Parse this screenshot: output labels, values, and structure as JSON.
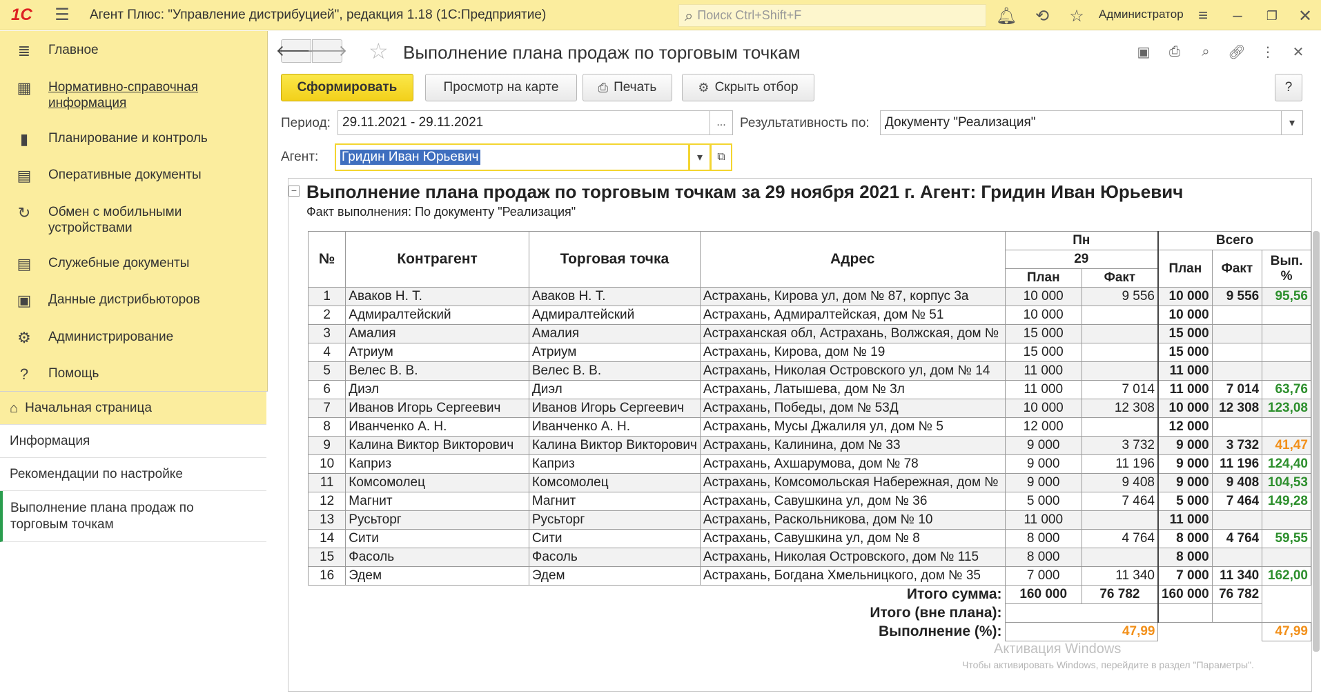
{
  "titlebar": {
    "logo": "1С",
    "title": "Агент Плюс: \"Управление дистрибуцией\", редакция 1.18  (1С:Предприятие)",
    "search_placeholder": "Поиск Ctrl+Shift+F",
    "user": "Администратор"
  },
  "sidebar": {
    "items": [
      {
        "label": "Главное",
        "icon": "menu-lines-icon"
      },
      {
        "label": "Нормативно-справочная информация",
        "icon": "grid-icon"
      },
      {
        "label": "Планирование и контроль",
        "icon": "bar-chart-icon"
      },
      {
        "label": "Оперативные документы",
        "icon": "documents-icon"
      },
      {
        "label": "Обмен с мобильными устройствами",
        "icon": "sync-icon"
      },
      {
        "label": "Служебные документы",
        "icon": "documents-icon"
      },
      {
        "label": "Данные дистрибьюторов",
        "icon": "distributor-icon"
      },
      {
        "label": "Администрирование",
        "icon": "gear-icon"
      },
      {
        "label": "Помощь",
        "icon": "help-icon"
      }
    ],
    "open_windows": [
      {
        "label": "Начальная страница"
      },
      {
        "label": "Информация"
      },
      {
        "label": "Рекомендации по настройке"
      },
      {
        "label": "Выполнение плана продаж по торговым точкам"
      }
    ]
  },
  "form": {
    "title": "Выполнение плана продаж по торговым точкам",
    "buttons": {
      "generate": "Сформировать",
      "map": "Просмотр на карте",
      "print": "Печать",
      "hide_filter": "Скрыть отбор",
      "help": "?"
    },
    "period_label": "Период:",
    "period_value": "29.11.2021 - 29.11.2021",
    "period_btn": "...",
    "result_label": "Результативность по:",
    "result_value": "Документу \"Реализация\"",
    "agent_label": "Агент:",
    "agent_value": "Гридин Иван Юрьевич"
  },
  "report": {
    "title": "Выполнение плана продаж по торговым точкам за 29 ноября 2021 г.   Агент: Гридин Иван Юрьевич",
    "subtitle": "Факт выполнения: По документу \"Реализация\"",
    "headers": {
      "num": "№",
      "client": "Контрагент",
      "outlet": "Торговая точка",
      "address": "Адрес",
      "day": "Пн",
      "date": "29",
      "plan": "План",
      "fact": "Факт",
      "total": "Всего",
      "pct": "Вып. %"
    },
    "rows": [
      {
        "n": "1",
        "client": "Аваков Н. Т.",
        "outlet": "Аваков Н. Т.",
        "address": "Астрахань, Кирова ул, дом № 87, корпус 3а",
        "plan": "10 000",
        "fact": "9 556",
        "tplan": "10 000",
        "tfact": "9 556",
        "pct": "95,56",
        "pct_color": "green"
      },
      {
        "n": "2",
        "client": "Адмиралтейский",
        "outlet": "Адмиралтейский",
        "address": "Астрахань, Адмиралтейская, дом № 51",
        "plan": "10 000",
        "fact": "",
        "tplan": "10 000",
        "tfact": "",
        "pct": "",
        "pct_color": ""
      },
      {
        "n": "3",
        "client": "Амалия",
        "outlet": "Амалия",
        "address": "Астраханская обл, Астрахань, Волжская, дом №",
        "plan": "15 000",
        "fact": "",
        "tplan": "15 000",
        "tfact": "",
        "pct": "",
        "pct_color": ""
      },
      {
        "n": "4",
        "client": "Атриум",
        "outlet": "Атриум",
        "address": "Астрахань, Кирова, дом № 19",
        "plan": "15 000",
        "fact": "",
        "tplan": "15 000",
        "tfact": "",
        "pct": "",
        "pct_color": ""
      },
      {
        "n": "5",
        "client": "Велес В. В.",
        "outlet": "Велес В. В.",
        "address": "Астрахань, Николая Островского ул, дом № 14",
        "plan": "11 000",
        "fact": "",
        "tplan": "11 000",
        "tfact": "",
        "pct": "",
        "pct_color": ""
      },
      {
        "n": "6",
        "client": "Диэл",
        "outlet": "Диэл",
        "address": "Астрахань, Латышева, дом № 3л",
        "plan": "11 000",
        "fact": "7 014",
        "tplan": "11 000",
        "tfact": "7 014",
        "pct": "63,76",
        "pct_color": "green"
      },
      {
        "n": "7",
        "client": "Иванов Игорь Сергеевич",
        "outlet": "Иванов Игорь Сергеевич",
        "address": "Астрахань, Победы, дом № 53Д",
        "plan": "10 000",
        "fact": "12 308",
        "tplan": "10 000",
        "tfact": "12 308",
        "pct": "123,08",
        "pct_color": "green"
      },
      {
        "n": "8",
        "client": "Иванченко А. Н.",
        "outlet": "Иванченко А. Н.",
        "address": "Астрахань, Мусы Джалиля ул, дом № 5",
        "plan": "12 000",
        "fact": "",
        "tplan": "12 000",
        "tfact": "",
        "pct": "",
        "pct_color": ""
      },
      {
        "n": "9",
        "client": "Калина Виктор Викторович",
        "outlet": "Калина Виктор Викторович",
        "address": "Астрахань, Калинина, дом № 33",
        "plan": "9 000",
        "fact": "3 732",
        "tplan": "9 000",
        "tfact": "3 732",
        "pct": "41,47",
        "pct_color": "orange"
      },
      {
        "n": "10",
        "client": "Каприз",
        "outlet": "Каприз",
        "address": "Астрахань, Ахшарумова, дом № 78",
        "plan": "9 000",
        "fact": "11 196",
        "tplan": "9 000",
        "tfact": "11 196",
        "pct": "124,40",
        "pct_color": "green"
      },
      {
        "n": "11",
        "client": "Комсомолец",
        "outlet": "Комсомолец",
        "address": "Астрахань, Комсомольская Набережная, дом №",
        "plan": "9 000",
        "fact": "9 408",
        "tplan": "9 000",
        "tfact": "9 408",
        "pct": "104,53",
        "pct_color": "green"
      },
      {
        "n": "12",
        "client": "Магнит",
        "outlet": "Магнит",
        "address": "Астрахань, Савушкина ул, дом № 36",
        "plan": "5 000",
        "fact": "7 464",
        "tplan": "5 000",
        "tfact": "7 464",
        "pct": "149,28",
        "pct_color": "green"
      },
      {
        "n": "13",
        "client": "Русьторг",
        "outlet": "Русьторг",
        "address": "Астрахань, Раскольникова, дом № 10",
        "plan": "11 000",
        "fact": "",
        "tplan": "11 000",
        "tfact": "",
        "pct": "",
        "pct_color": ""
      },
      {
        "n": "14",
        "client": "Сити",
        "outlet": "Сити",
        "address": "Астрахань, Савушкина ул, дом № 8",
        "plan": "8 000",
        "fact": "4 764",
        "tplan": "8 000",
        "tfact": "4 764",
        "pct": "59,55",
        "pct_color": "green"
      },
      {
        "n": "15",
        "client": "Фасоль",
        "outlet": "Фасоль",
        "address": "Астрахань, Николая Островского, дом № 115",
        "plan": "8 000",
        "fact": "",
        "tplan": "8 000",
        "tfact": "",
        "pct": "",
        "pct_color": ""
      },
      {
        "n": "16",
        "client": "Эдем",
        "outlet": "Эдем",
        "address": "Астрахань, Богдана Хмельницкого, дом № 35",
        "plan": "7 000",
        "fact": "11 340",
        "tplan": "7 000",
        "tfact": "11 340",
        "pct": "162,00",
        "pct_color": "green"
      }
    ],
    "totals": {
      "sum_label": "Итого сумма:",
      "sum_plan": "160 000",
      "sum_fact": "76 782",
      "sum_tplan": "160 000",
      "sum_tfact": "76 782",
      "outside_label": "Итого (вне плана):",
      "exec_label": "Выполнение (%):",
      "exec_day": "47,99",
      "exec_total": "47,99"
    },
    "colors": {
      "green": "#2d8f2d",
      "orange": "#f2901a"
    }
  },
  "watermark": {
    "line1": "Активация Windows",
    "line2": "Чтобы активировать Windows, перейдите в раздел \"Параметры\"."
  }
}
